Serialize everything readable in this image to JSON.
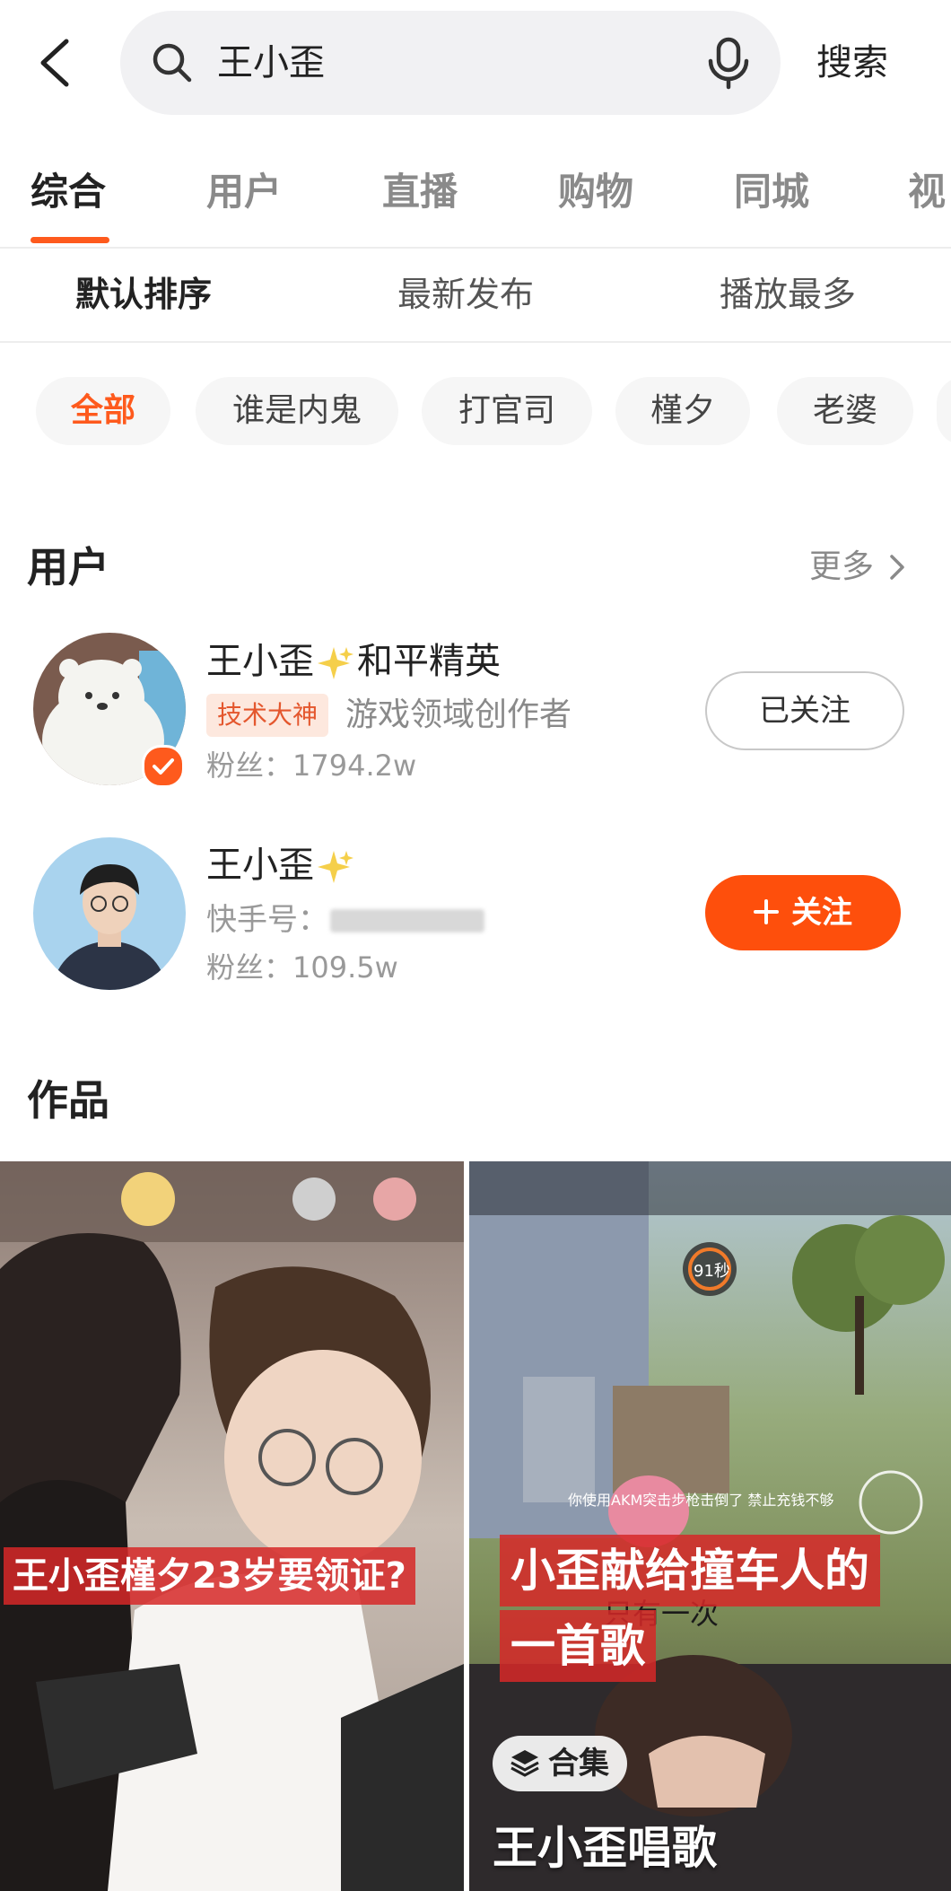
{
  "search": {
    "query": "王小歪",
    "button_label": "搜索"
  },
  "tabs": [
    {
      "label": "综合",
      "active": true
    },
    {
      "label": "用户",
      "active": false
    },
    {
      "label": "直播",
      "active": false
    },
    {
      "label": "购物",
      "active": false
    },
    {
      "label": "同城",
      "active": false
    },
    {
      "label": "视",
      "active": false
    }
  ],
  "sort": [
    {
      "label": "默认排序",
      "active": true
    },
    {
      "label": "最新发布",
      "active": false
    },
    {
      "label": "播放最多",
      "active": false
    }
  ],
  "chips": [
    {
      "label": "全部",
      "active": true
    },
    {
      "label": "谁是内鬼",
      "active": false
    },
    {
      "label": "打官司",
      "active": false
    },
    {
      "label": "槿夕",
      "active": false
    },
    {
      "label": "老婆",
      "active": false
    }
  ],
  "users_section": {
    "title": "用户",
    "more_label": "更多"
  },
  "users": [
    {
      "name": "王小歪",
      "name_suffix": "和平精英",
      "tag": "技术大神",
      "creator_label": "游戏领域创作者",
      "fans": "粉丝：1794.2w",
      "verified": true,
      "button_label": "已关注"
    },
    {
      "name": "王小歪",
      "kuaishou_id_label": "快手号：",
      "fans": "粉丝：109.5w",
      "button_label": "关注"
    }
  ],
  "works_section": {
    "title": "作品"
  },
  "videos": [
    {
      "caption": "王小歪槿夕23岁要领证?"
    },
    {
      "caption_line1": "小歪献给撞车人的",
      "caption_line2": "一首歌",
      "badge": "合集",
      "title": "王小歪唱歌",
      "game_hud_text": "你使用AKM突击步枪击倒了 禁止充钱不够",
      "game_hud_lyrics": "只有一次",
      "game_hud_timer": "91秒"
    }
  ],
  "colors": {
    "accent": "#fe5a1d",
    "follow_button": "#fe4f0c",
    "tag_bg": "#fde8de"
  }
}
